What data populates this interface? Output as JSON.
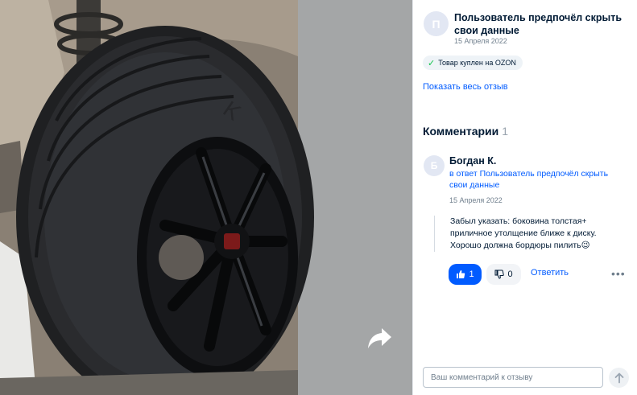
{
  "review": {
    "avatar_letter": "П",
    "author": "Пользователь предпочёл скрыть свои данные",
    "date": "15 Апреля 2022",
    "badge": "Товар куплен на OZON",
    "show_full": "Показать весь отзыв"
  },
  "comments_section": {
    "title": "Комментарии",
    "count": "1"
  },
  "comment": {
    "avatar_letter": "Б",
    "author": "Богдан К.",
    "reply_to": "в ответ Пользователь предпочёл скрыть свои данные",
    "date": "15 Апреля 2022",
    "text": "Забыл указать: боковина толстая+ приличное утолщение ближе к диску. Хорошо должна бордюры пилить😉",
    "likes": "1",
    "dislikes": "0",
    "reply_label": "Ответить",
    "more": "•••"
  },
  "comment_form": {
    "placeholder": "Ваш комментарий к отзыву"
  },
  "colors": {
    "accent": "#005bff",
    "success": "#10c44c",
    "text": "#001a34",
    "muted": "#707f8d"
  },
  "icons": {
    "share": "share-arrow-icon",
    "check": "check-icon",
    "like": "thumbs-up-icon",
    "dislike": "thumbs-down-icon",
    "send": "arrow-up-icon"
  }
}
